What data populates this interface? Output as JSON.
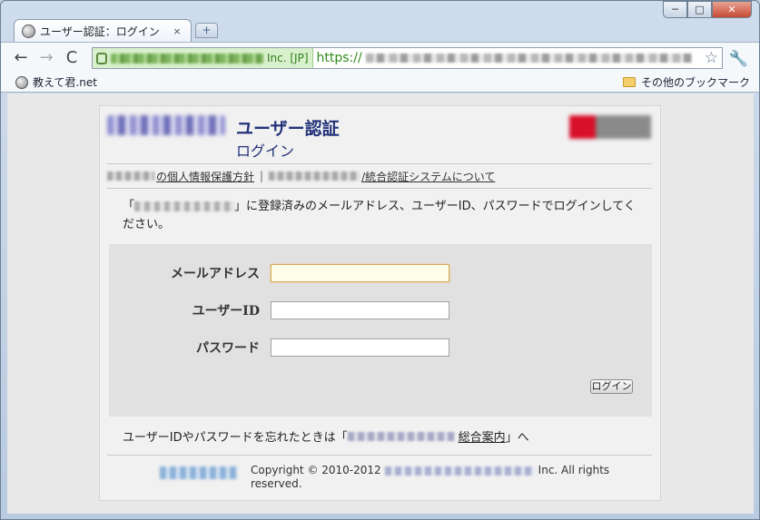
{
  "browser": {
    "tab_title": "ユーザー認証：ログイン",
    "tab_close": "×",
    "newtab_label": "+",
    "window_buttons": {
      "minimize": "─",
      "maximize": "□",
      "close": "✕"
    },
    "toolbar": {
      "back": "←",
      "forward": "→",
      "reload": "C"
    },
    "omnibox": {
      "ssl_org_suffix": "Inc. [JP]",
      "url_scheme": "https://"
    },
    "star_icon": "☆",
    "wrench_icon": "🔧",
    "bookmarks": {
      "left_item": "教えて君.net",
      "other_bookmarks": "その他のブックマーク"
    }
  },
  "page": {
    "header": {
      "title": "ユーザー認証",
      "subtitle": "ログイン"
    },
    "links": {
      "privacy": "の個人情報保護方針",
      "separator": "|",
      "about": "/統合認証システムについて"
    },
    "intro": {
      "open_quote": "「",
      "text": "」に登録済みのメールアドレス、ユーザーID、パスワードでログインしてください。"
    },
    "form": {
      "email_label": "メールアドレス",
      "email_value": "",
      "userid_label": "ユーザーID",
      "userid_value": "",
      "password_label": "パスワード",
      "password_value": "",
      "login_button": "ログイン"
    },
    "forgot": {
      "prefix": "ユーザーIDやパスワードを忘れたときは「",
      "link_suffix": "総合案内",
      "suffix": "」へ"
    },
    "footer": {
      "copyright_prefix": "Copyright © 2010-2012",
      "copyright_suffix": "Inc. All rights reserved."
    }
  },
  "colors": {
    "header_text": "#23327a",
    "ssl_green": "#2e8b1a",
    "brand_red": "#d8102a"
  }
}
